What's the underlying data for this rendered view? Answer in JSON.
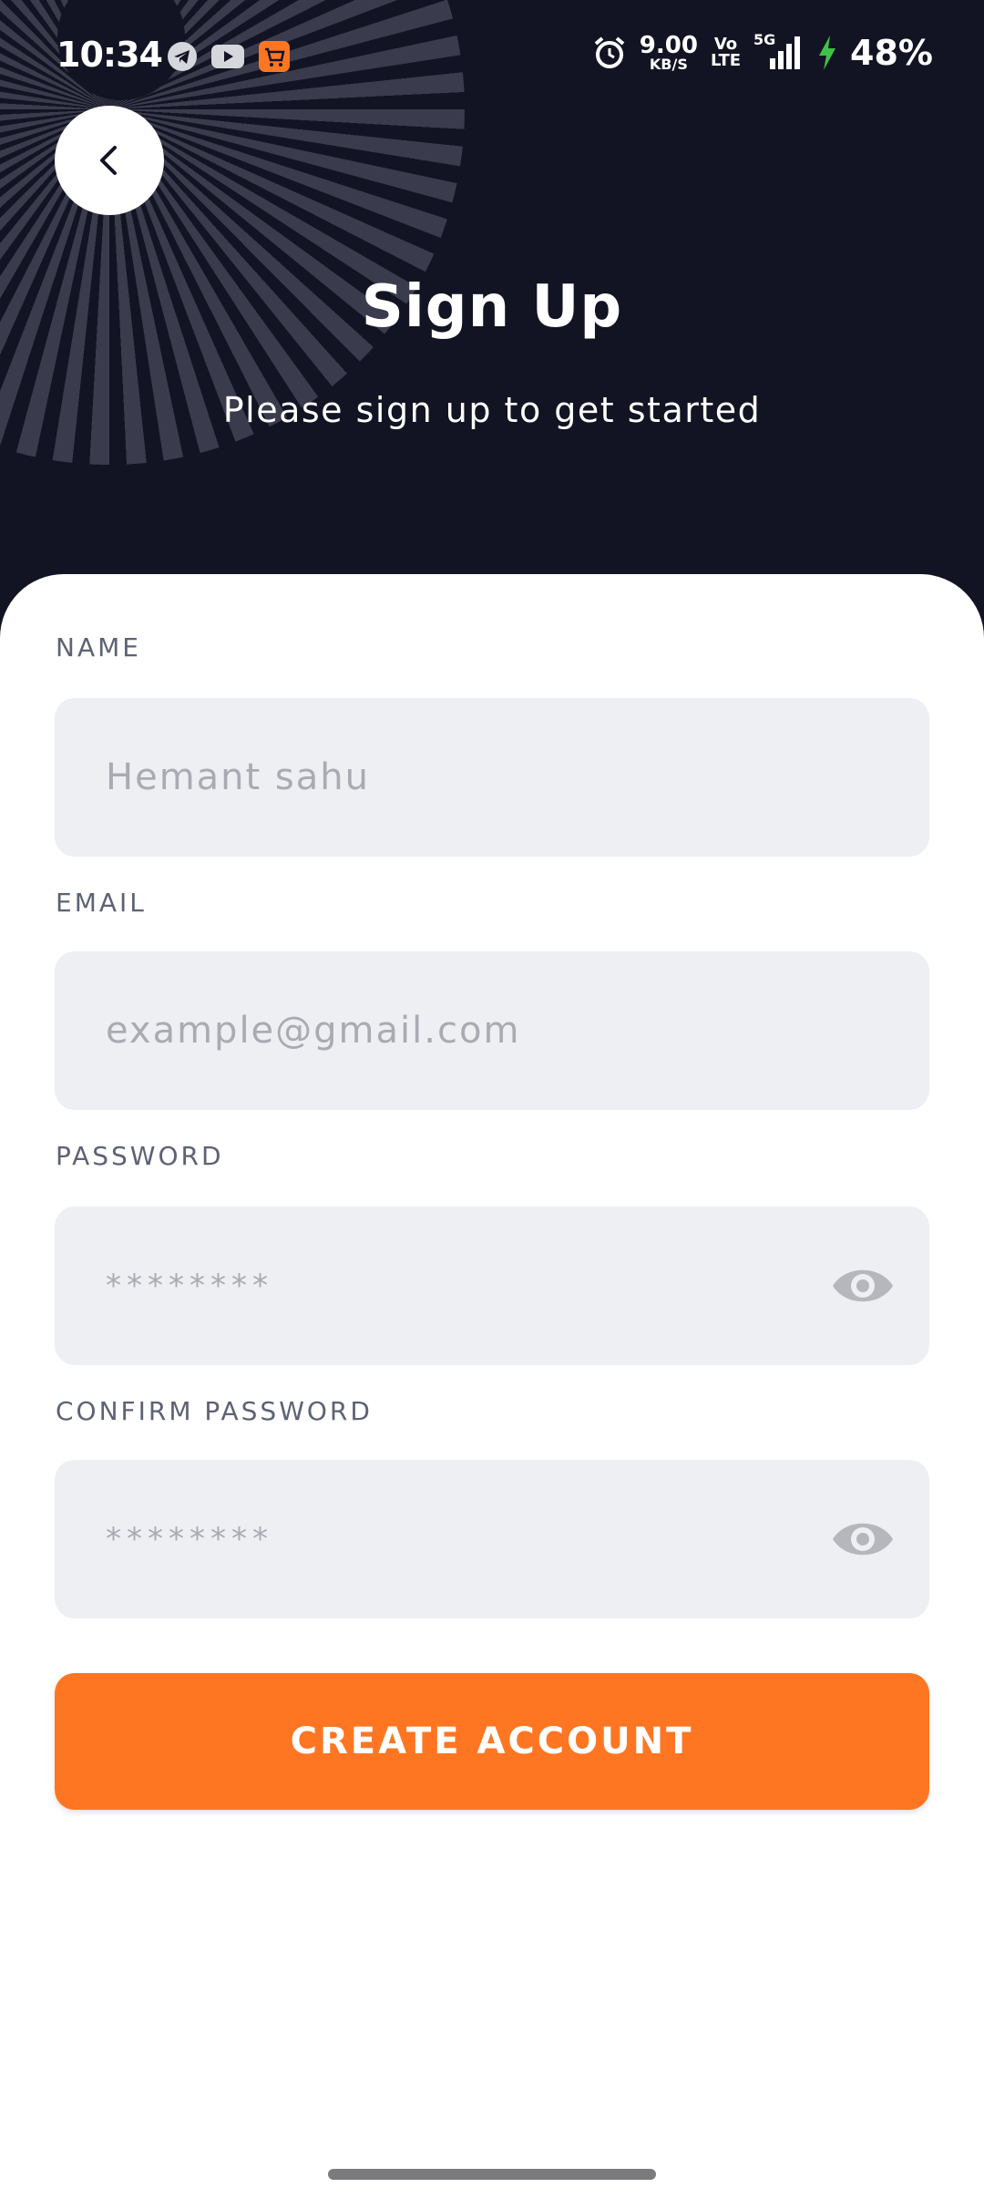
{
  "status_bar": {
    "time": "10:34",
    "net_speed": "9.00",
    "net_speed_unit": "KB/S",
    "volte_top": "Vo",
    "volte_bottom": "LTE",
    "network": "5G",
    "battery": "48%"
  },
  "header": {
    "title": "Sign Up",
    "subtitle": "Please sign up to get started"
  },
  "form": {
    "name_label": "NAME",
    "name_placeholder": "Hemant sahu",
    "email_label": "EMAIL",
    "email_placeholder": "example@gmail.com",
    "password_label": "PASSWORD",
    "password_placeholder": "********",
    "confirm_label": "CONFIRM PASSWORD",
    "confirm_placeholder": "********"
  },
  "actions": {
    "create_account_label": "CREATE ACCOUNT"
  },
  "colors": {
    "header_bg": "#131423",
    "accent": "#ff7622",
    "field_bg": "#eeeff2"
  },
  "icons": [
    "back-arrow-icon",
    "telegram-icon",
    "youtube-icon",
    "shop-app-icon",
    "alarm-icon",
    "signal-icon",
    "charging-icon",
    "eye-icon"
  ]
}
